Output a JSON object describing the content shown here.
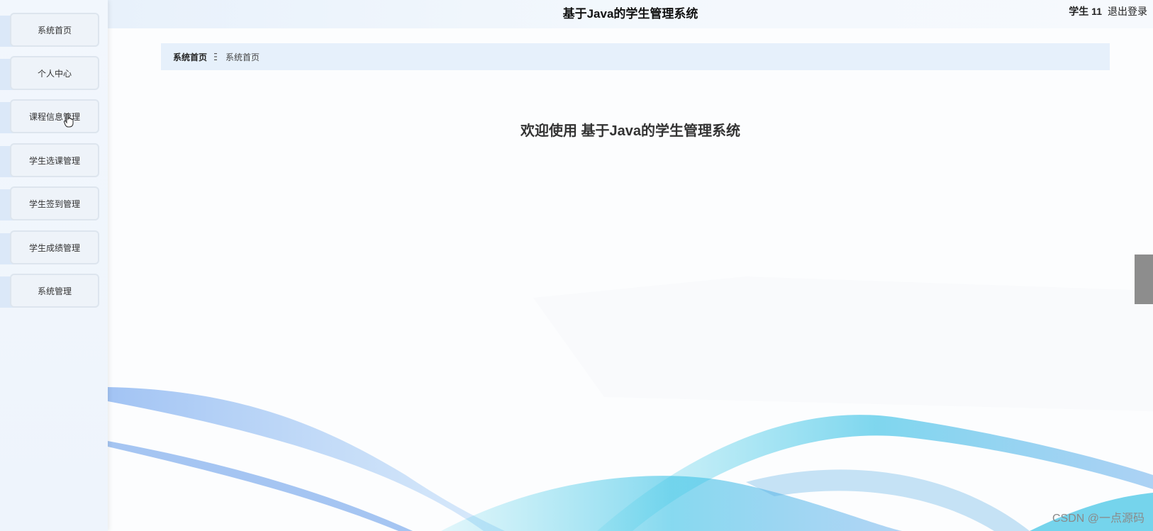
{
  "header": {
    "title": "基于Java的学生管理系统",
    "user": "学生 11",
    "logout_label": "退出登录"
  },
  "sidebar": {
    "items": [
      {
        "label": "系统首页"
      },
      {
        "label": "个人中心"
      },
      {
        "label": "课程信息管理"
      },
      {
        "label": "学生选课管理"
      },
      {
        "label": "学生签到管理"
      },
      {
        "label": "学生成绩管理"
      },
      {
        "label": "系统管理"
      }
    ]
  },
  "breadcrumb": {
    "first": "系统首页",
    "current": "系统首页"
  },
  "main": {
    "welcome": "欢迎使用 基于Java的学生管理系统"
  },
  "watermark": "CSDN @一点源码",
  "colors": {
    "sidebar_bg": "#f2f7fd",
    "breadcrumb_bg": "#e6f0fb",
    "wave_blue": "#4a8fe8",
    "wave_cyan": "#3cc8e8",
    "scroll_handle": "#8d8d8d"
  }
}
